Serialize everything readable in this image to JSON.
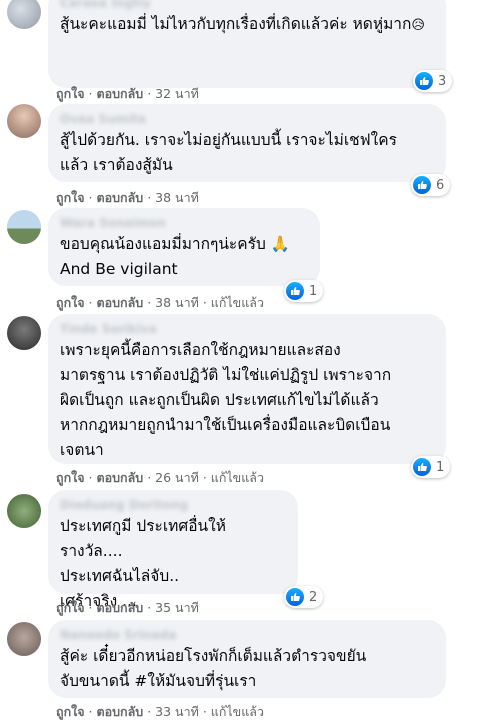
{
  "comments": [
    {
      "author": "Caraoa Ingtiy",
      "text": "สู้นะคะแอมมี่ ไม่ไหวกับทุกเรื่องที่เกิดแล้วค่ะ หดหู่มาก",
      "emoji": "😥",
      "like": "ถูกใจ",
      "reply": "ตอบกลับ",
      "time": "32 นาที",
      "edited": "",
      "reactions": "3"
    },
    {
      "author": "Ovaa Sumita",
      "text": "สู้ไปด้วยกัน. เราจะไม่อยู่กันแบบนี้ เราจะไม่เชฟใคร\nแล้ว เราต้องสู้มัน",
      "emoji": "",
      "like": "ถูกใจ",
      "reply": "ตอบกลับ",
      "time": "38 นาที",
      "edited": "",
      "reactions": "6"
    },
    {
      "author": "Wara Sonaimon",
      "text": "ขอบคุณน้องแอมมี่มากๆน่ะครับ 🙏\nAnd Be vigilant",
      "emoji": "",
      "like": "ถูกใจ",
      "reply": "ตอบกลับ",
      "time": "38 นาที",
      "edited": "แก้ไขแล้ว",
      "reactions": "1"
    },
    {
      "author": "Tinde Sorikiva",
      "text": "เพราะยุคนี้คือการเลือกใช้กฎหมายและสอง\nมาตรฐาน เราต้องปฏิวัติ ไม่ใช่แค่ปฏิรูป เพราะจาก\nผิดเป็นถูก และถูกเป็นผิด ประเทศแก้ไขไม่ได้แล้ว\nหากกฎหมายถูกนำมาใช้เป็นเครื่องมือและบิดเบือน\nเจตนา",
      "emoji": "",
      "like": "ถูกใจ",
      "reply": "ตอบกลับ",
      "time": "26 นาที",
      "edited": "แก้ไขแล้ว",
      "reactions": "1"
    },
    {
      "author": "Diaduang Doritong",
      "text": "ประเทศกูมี ประเทศอื่นให้รางวัล....\nประเทศฉันไล่จับ..\nเศร้าจริง ...",
      "emoji": "",
      "like": "ถูกใจ",
      "reply": "ตอบกลับ",
      "time": "35 นาที",
      "edited": "",
      "reactions": "2"
    },
    {
      "author": "Nanoodo Srinada",
      "text": "สู้ค่ะ เดี๋ยวอีกหน่อยโรงพักก็เต็มแล้วตำรวจขยัน\nจับขนาดนี้ #ให้มันจบที่รุ่นเรา",
      "emoji": "",
      "like": "ถูกใจ",
      "reply": "ตอบกลับ",
      "time": "33 นาที",
      "edited": "แก้ไขแล้ว",
      "reactions": ""
    }
  ],
  "colors": {
    "bubble": "#f0f2f5",
    "meta": "#65676b",
    "like": "#1877f2"
  },
  "icons": {
    "reaction": "thumbs-up-icon"
  }
}
